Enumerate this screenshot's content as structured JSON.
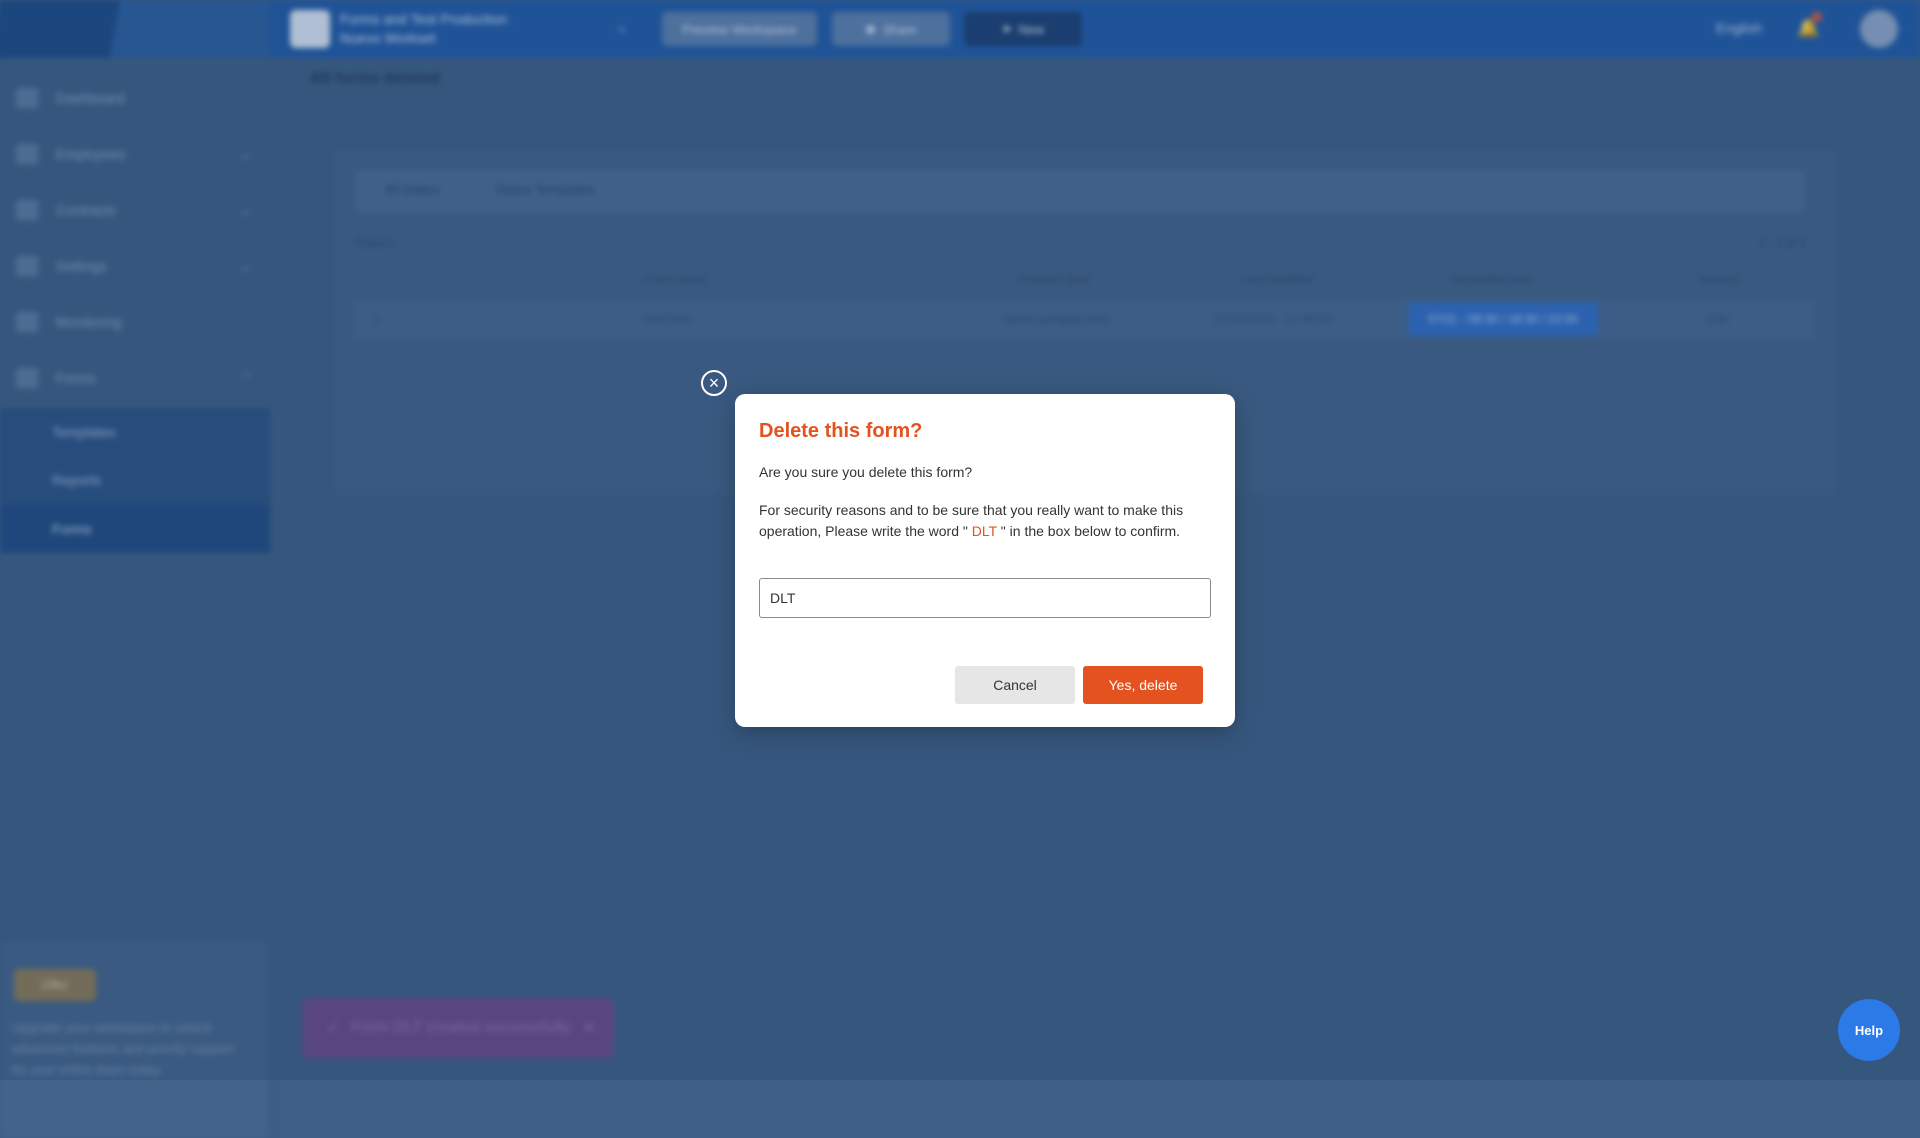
{
  "colors": {
    "accent": "#e3521f",
    "topbar": "#1f5aa6",
    "overlay_bg": "#3d5f85",
    "help_button": "#2c79e8"
  },
  "header": {
    "workspace_name_line1": "Forms and Test Production",
    "workspace_name_line2": "Nuevo Workset",
    "btn_preview": "Preview Workspace",
    "btn_share": "Share",
    "btn_new": "New",
    "language": "English"
  },
  "sidebar": {
    "items": [
      {
        "label": "Dashboard",
        "icon": "grid-icon"
      },
      {
        "label": "Employees",
        "icon": "people-icon"
      },
      {
        "label": "Contracts",
        "icon": "document-icon"
      },
      {
        "label": "Settings",
        "icon": "gear-icon"
      },
      {
        "label": "Monitoring",
        "icon": "chart-icon"
      },
      {
        "label": "Forms",
        "icon": "form-icon"
      }
    ],
    "subitems": [
      {
        "label": "Templates"
      },
      {
        "label": "Reports"
      },
      {
        "label": "Forms"
      }
    ],
    "promo": {
      "badge": "Offer",
      "text": "Upgrade your workspace to unlock advanced features and priority support for your entire team today."
    }
  },
  "main": {
    "title": "All forms deleted",
    "filter_1": "All Status",
    "filter_2": "Status Templates",
    "rows_label": "Rows 1",
    "pager": "1 - 1 of 1",
    "columns": [
      "Form name",
      "Program date",
      "Last modified",
      "Recording time",
      "Actions"
    ],
    "row": {
      "index": "1",
      "name": "test form",
      "program": "Nuevo program test",
      "modified": "07/11/2024 - 17:45:00",
      "recording": "07/11 - 09:30 / 18:30 / 22:00",
      "action": "Edit"
    }
  },
  "toast": {
    "text": "Form DLT created successfully"
  },
  "help_button": "Help",
  "modal": {
    "title": "Delete this form?",
    "question": "Are you sure you delete this form?",
    "message_before": "For security reasons and to be sure that you really want to make this operation, Please write the word \"",
    "keyword": " DLT ",
    "message_after": "\" in the box below to confirm.",
    "input_value": "DLT",
    "cancel_label": "Cancel",
    "confirm_label": "Yes, delete"
  }
}
